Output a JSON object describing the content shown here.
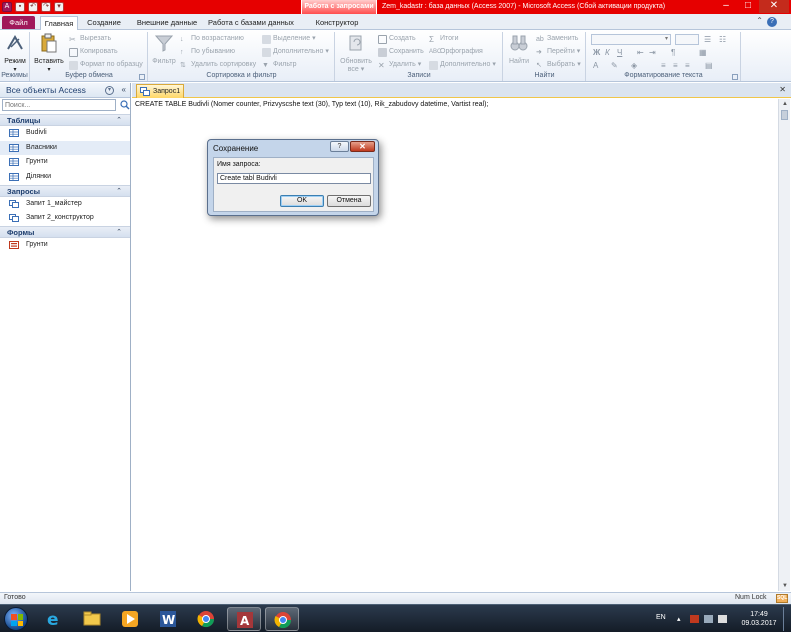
{
  "titlebar": {
    "context_tab_title": "Работа с запросами",
    "app_title": "Zem_kadastr : база данных (Access 2007)  -  Microsoft Access (Сбой активации продукта)",
    "minimize": "–",
    "maximize": "□",
    "close": "✕"
  },
  "tabs": {
    "file": "Файл",
    "home": "Главная",
    "create": "Создание",
    "external": "Внешние данные",
    "database": "Работа с базами данных",
    "design": "Конструктор"
  },
  "ribbon": {
    "views": {
      "mode": "Режим",
      "label": "Режимы"
    },
    "clipboard": {
      "paste": "Вставить",
      "cut": "Вырезать",
      "copy": "Копировать",
      "format_painter": "Формат по образцу",
      "label": "Буфер обмена"
    },
    "sort_filter": {
      "filter": "Фильтр",
      "ascending": "По возрастанию",
      "descending": "По убыванию",
      "remove_sort": "Удалить сортировку",
      "selection": "Выделение",
      "advanced": "Дополнительно",
      "toggle_filter": "Фильтр",
      "label": "Сортировка и фильтр"
    },
    "records": {
      "refresh": "Обновить",
      "refresh2": "все",
      "new": "Создать",
      "save": "Сохранить",
      "delete": "Удалить",
      "totals": "Итоги",
      "spelling": "Орфография",
      "more": "Дополнительно",
      "label": "Записи"
    },
    "find": {
      "find": "Найти",
      "replace": "Заменить",
      "goto": "Перейти",
      "select": "Выбрать",
      "label": "Найти"
    },
    "text_format": {
      "bold": "Ж",
      "italic": "К",
      "underline": "Ч",
      "label": "Форматирование текста"
    }
  },
  "nav": {
    "title": "Все объекты Access",
    "search_placeholder": "Поиск...",
    "sections": [
      {
        "title": "Таблицы",
        "items": [
          "Budivli",
          "Власники",
          "Грунти",
          "Ділянки"
        ]
      },
      {
        "title": "Запросы",
        "items": [
          "Запит 1_майстер",
          "Запит 2_конструктор"
        ]
      },
      {
        "title": "Формы",
        "items": [
          "Грунти"
        ]
      }
    ]
  },
  "document": {
    "tab_label": "Запрос1",
    "sql_text": "CREATE TABLE Budivli (Nomer counter, Prizvyscshe text (30), Typ text (10), Rik_zabudovy datetime, Vartist real);"
  },
  "dialog": {
    "title": "Сохранение",
    "help": "?",
    "close": "✕",
    "field_label": "Имя запроса:",
    "field_value": "Create tabl Budivli",
    "ok": "OK",
    "cancel": "Отмена"
  },
  "statusbar": {
    "status": "Готово",
    "numlock": "Num Lock",
    "sql_icon": "SQL"
  },
  "taskbar": {
    "lang": "EN",
    "time": "17:49",
    "date": "09.03.2017"
  },
  "colors": {
    "title_red": "#e60000",
    "file_tab": "#a0185a",
    "doc_tab": "#ffd766",
    "ribbon_bg": "#e8eef7",
    "taskbar": "#141c27"
  }
}
